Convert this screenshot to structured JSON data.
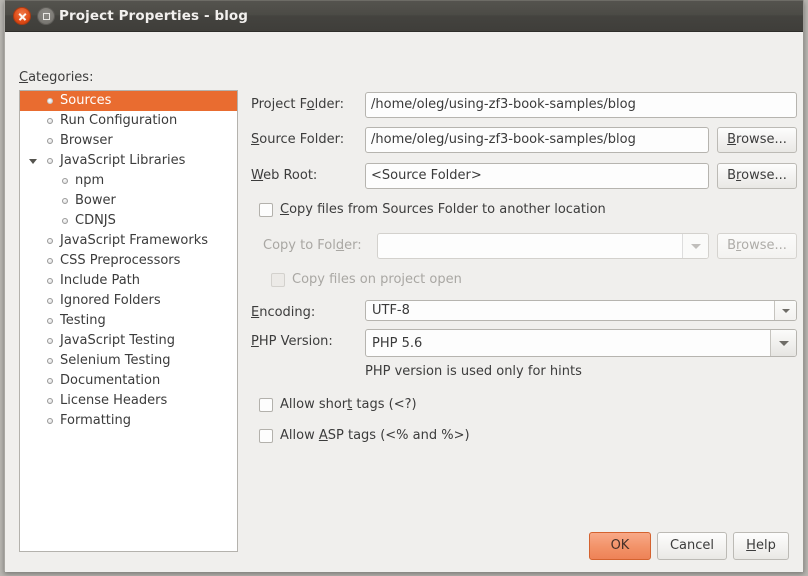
{
  "window": {
    "title": "Project Properties - blog",
    "close_icon": "close-icon",
    "maximize_icon": "maximize-icon"
  },
  "sidebar": {
    "label": "Categories:",
    "items": [
      {
        "label": "Sources",
        "depth": 0,
        "selected": true,
        "arrow": false
      },
      {
        "label": "Run Configuration",
        "depth": 0,
        "selected": false,
        "arrow": false
      },
      {
        "label": "Browser",
        "depth": 0,
        "selected": false,
        "arrow": false
      },
      {
        "label": "JavaScript Libraries",
        "depth": 0,
        "selected": false,
        "arrow": true
      },
      {
        "label": "npm",
        "depth": 1,
        "selected": false,
        "arrow": false
      },
      {
        "label": "Bower",
        "depth": 1,
        "selected": false,
        "arrow": false
      },
      {
        "label": "CDNJS",
        "depth": 1,
        "selected": false,
        "arrow": false
      },
      {
        "label": "JavaScript Frameworks",
        "depth": 0,
        "selected": false,
        "arrow": false
      },
      {
        "label": "CSS Preprocessors",
        "depth": 0,
        "selected": false,
        "arrow": false
      },
      {
        "label": "Include Path",
        "depth": 0,
        "selected": false,
        "arrow": false
      },
      {
        "label": "Ignored Folders",
        "depth": 0,
        "selected": false,
        "arrow": false
      },
      {
        "label": "Testing",
        "depth": 0,
        "selected": false,
        "arrow": false
      },
      {
        "label": "JavaScript Testing",
        "depth": 0,
        "selected": false,
        "arrow": false
      },
      {
        "label": "Selenium Testing",
        "depth": 0,
        "selected": false,
        "arrow": false
      },
      {
        "label": "Documentation",
        "depth": 0,
        "selected": false,
        "arrow": false
      },
      {
        "label": "License Headers",
        "depth": 0,
        "selected": false,
        "arrow": false
      },
      {
        "label": "Formatting",
        "depth": 0,
        "selected": false,
        "arrow": false
      }
    ]
  },
  "form": {
    "project_folder": {
      "label": "Project Folder:",
      "label_mnemonic": "o",
      "value": "/home/oleg/using-zf3-book-samples/blog"
    },
    "source_folder": {
      "label": "Source Folder:",
      "label_mnemonic": "S",
      "value": "/home/oleg/using-zf3-book-samples/blog",
      "browse_label": "Browse...",
      "browse_mnemonic": "B"
    },
    "web_root": {
      "label": "Web Root:",
      "label_mnemonic": "W",
      "value": "<Source Folder>",
      "browse_label": "Browse...",
      "browse_mnemonic": "r"
    },
    "copy_files": {
      "label": "Copy files from Sources Folder to another location",
      "label_mnemonic": "C",
      "checked": false
    },
    "copy_to_folder": {
      "label": "Copy to Folder:",
      "label_mnemonic": "d",
      "value": "",
      "enabled": false,
      "browse_label": "Browse...",
      "browse_mnemonic": "r"
    },
    "copy_on_open": {
      "label": "Copy files on project open",
      "checked": false,
      "enabled": false
    },
    "encoding": {
      "label": "Encoding:",
      "label_mnemonic": "E",
      "value": "UTF-8"
    },
    "php_version": {
      "label": "PHP Version:",
      "label_mnemonic": "P",
      "value": "PHP 5.6"
    },
    "php_hint": "PHP version is used only for hints",
    "allow_short_tags": {
      "label": "Allow short tags (<?)",
      "checked": false
    },
    "allow_asp_tags": {
      "label": "Allow ASP tags (<% and %>)",
      "checked": false
    }
  },
  "footer": {
    "ok_label": "OK",
    "cancel_label": "Cancel",
    "help_label": "Help"
  },
  "colors": {
    "accent": "#e96c30",
    "primary_button": "#f29268",
    "titlebar": "#4a4945",
    "window_bg": "#f0efed"
  }
}
